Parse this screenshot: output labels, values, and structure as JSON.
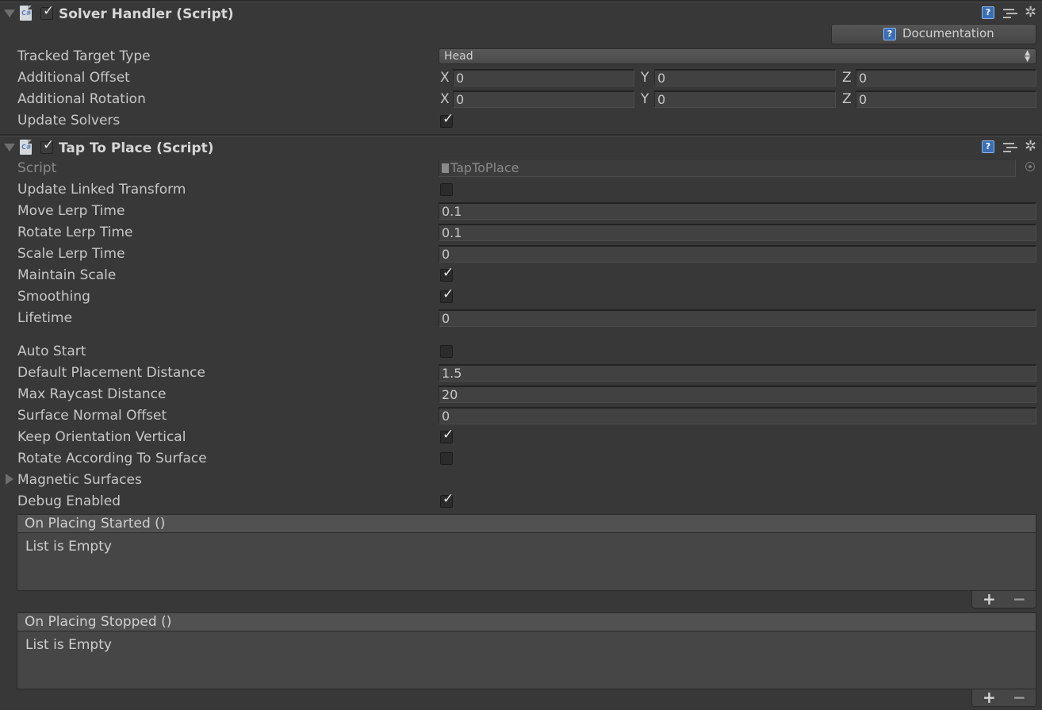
{
  "solver_handler": {
    "title": "Solver Handler (Script)",
    "enabled": true,
    "documentation_label": "Documentation",
    "tracked_target_type": {
      "label": "Tracked Target Type",
      "value": "Head"
    },
    "additional_offset": {
      "label": "Additional Offset",
      "x_label": "X",
      "y_label": "Y",
      "z_label": "Z",
      "x": "0",
      "y": "0",
      "z": "0"
    },
    "additional_rotation": {
      "label": "Additional Rotation",
      "x_label": "X",
      "y_label": "Y",
      "z_label": "Z",
      "x": "0",
      "y": "0",
      "z": "0"
    },
    "update_solvers": {
      "label": "Update Solvers",
      "checked": true
    }
  },
  "tap_to_place": {
    "title": "Tap To Place (Script)",
    "enabled": true,
    "script": {
      "label": "Script",
      "value": "TapToPlace"
    },
    "update_linked_transform": {
      "label": "Update Linked Transform",
      "checked": false
    },
    "move_lerp_time": {
      "label": "Move Lerp Time",
      "value": "0.1"
    },
    "rotate_lerp_time": {
      "label": "Rotate Lerp Time",
      "value": "0.1"
    },
    "scale_lerp_time": {
      "label": "Scale Lerp Time",
      "value": "0"
    },
    "maintain_scale": {
      "label": "Maintain Scale",
      "checked": true
    },
    "smoothing": {
      "label": "Smoothing",
      "checked": true
    },
    "lifetime": {
      "label": "Lifetime",
      "value": "0"
    },
    "auto_start": {
      "label": "Auto Start",
      "checked": false
    },
    "default_placement_distance": {
      "label": "Default Placement Distance",
      "value": "1.5"
    },
    "max_raycast_distance": {
      "label": "Max Raycast Distance",
      "value": "20"
    },
    "surface_normal_offset": {
      "label": "Surface Normal Offset",
      "value": "0"
    },
    "keep_orientation_vertical": {
      "label": "Keep Orientation Vertical",
      "checked": true
    },
    "rotate_according_to_surface": {
      "label": "Rotate According To Surface",
      "checked": false
    },
    "magnetic_surfaces": {
      "label": "Magnetic Surfaces"
    },
    "debug_enabled": {
      "label": "Debug Enabled",
      "checked": true
    },
    "on_placing_started": {
      "header": "On Placing Started ()",
      "body": "List is Empty",
      "add": "+",
      "remove": "−"
    },
    "on_placing_stopped": {
      "header": "On Placing Stopped ()",
      "body": "List is Empty",
      "add": "+",
      "remove": "−"
    }
  },
  "glyphs": {
    "check": "✓",
    "gear": "✲",
    "help": "?"
  },
  "colors": {
    "background": "#383838",
    "help_icon": "#3a6fb8",
    "field_bg": "#414141"
  },
  "icons": [
    "foldout-arrow",
    "csharp-script-icon",
    "help-icon",
    "presets-icon",
    "gear-icon",
    "object-picker-icon"
  ]
}
